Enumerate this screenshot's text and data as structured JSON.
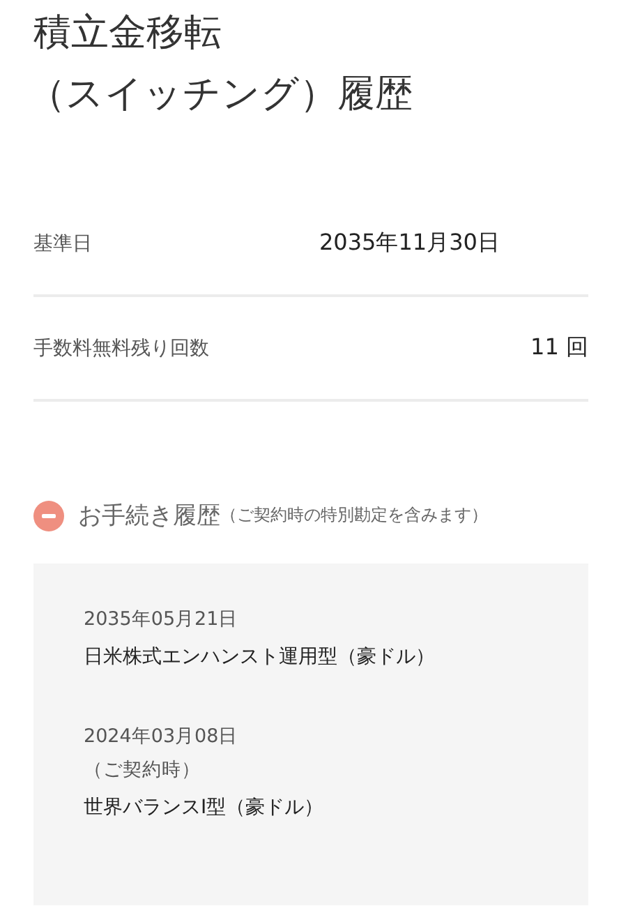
{
  "title": [
    "積立金移転",
    "（スイッチング）履歴"
  ],
  "summary": [
    {
      "label": "基準日",
      "value": "2035年11月30日"
    },
    {
      "label": "手数料無料残り回数",
      "value": "11 回"
    }
  ],
  "history": {
    "title": "お手続き履歴",
    "note": "（ご契約時の特別勘定を含みます）",
    "expanded": true,
    "entries": [
      {
        "date": "2035年05月21日",
        "fund": "日米株式エンハンスト運用型（豪ドル）"
      },
      {
        "date": "2024年03月08日",
        "remark": "（ご契約時）",
        "fund": "世界バランスI型（豪ドル）"
      }
    ]
  }
}
